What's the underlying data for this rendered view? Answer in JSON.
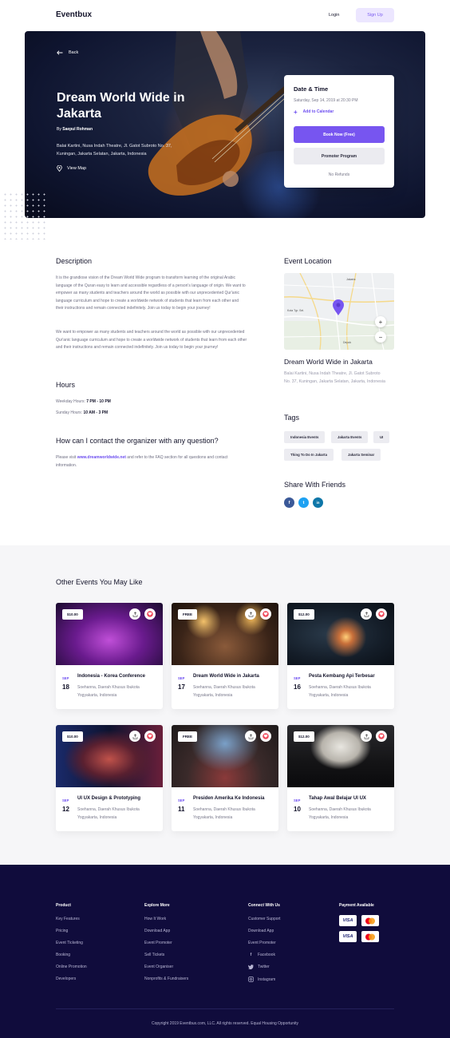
{
  "header": {
    "logo": "Eventbux",
    "login_label": "Login",
    "signup_label": "Sign Up"
  },
  "hero": {
    "back_label": "Back",
    "title": "Dream World Wide in Jakarta",
    "by_prefix": "By",
    "organizer": "Saepul Rohman",
    "address": "Balai Kartini, Nusa Indah Theatre, Jl. Gatot Subroto No. 37, Kuningan, Jakarta Selatan, Jakarta, Indonesia",
    "view_map_label": "View Map"
  },
  "datetime_card": {
    "title": "Date & Time",
    "date": "Saturday, Sep 14, 2019 at 20:30 PM",
    "add_calendar_label": "Add to Calendar",
    "book_label": "Book Now (Free)",
    "promoter_label": "Promoter Program",
    "no_refunds": "No Refunds"
  },
  "description": {
    "heading": "Description",
    "para1": "It is the grandiose vision of the Dream World Wide program to transform learning of the original Arabic language of the Quran easy to learn and accessible regardless of a person's language of origin. We want to empower as many students and teachers around the world as possible with our unprecedented Qur'anic language curriculum and hope to create a worldwide network of students that learn from each other and their instructions and remain connected indefinitely. Join us today to begin your journey!",
    "para2": "We want to empower as many students and teachers around the world as possible with our unprecedented Qur'anic language curriculum and hope to create a worldwide network of students that learn from each other and their instructions and remain connected indefinitely. Join us today to begin your journey!"
  },
  "hours": {
    "heading": "Hours",
    "weekday_label": "Weekday Hours:",
    "weekday_value": "7 PM - 10 PM",
    "sunday_label": "Sunday Hours:",
    "sunday_value": "10 AM - 3 PM"
  },
  "contact": {
    "heading": "How can I contact the organizer with any question?",
    "prefix": "Please visit",
    "link": "www.dreamworldwide.net",
    "suffix": "and refer to the FAQ section for all questions and contact information."
  },
  "location": {
    "heading": "Event Location",
    "map_labels": [
      "Jakarta",
      "Kota Tgr. Sel.",
      "Depok"
    ],
    "zoom_in": "+",
    "zoom_out": "−",
    "venue_title": "Dream World Wide in Jakarta",
    "venue_address": "Balai Kartini, Nusa Indah Theatre, Jl. Gatot Subroto No. 37, Kuningan, Jakarta Selatan, Jakarta, Indonesia"
  },
  "tags": {
    "heading": "Tags",
    "items": [
      "Indonesia Events",
      "Jakarta Events",
      "UI",
      "Thing To Do In Jakarta",
      "Jakarta Seminar"
    ]
  },
  "share": {
    "heading": "Share With Friends",
    "networks": [
      {
        "name": "facebook",
        "glyph": "f",
        "color": "#3b5998"
      },
      {
        "name": "twitter",
        "glyph": "t",
        "color": "#1da1f2"
      },
      {
        "name": "linkedin",
        "glyph": "in",
        "color": "#0e76a8"
      }
    ]
  },
  "other_events": {
    "heading": "Other Events You May Like",
    "events": [
      {
        "price": "$10.00",
        "month": "SEP",
        "day": "18",
        "title": "Indonesia - Korea Conference",
        "location": "Soehanna, Daerah Khusus Ibukota Yogyakarta, Indonesia"
      },
      {
        "price": "FREE",
        "month": "SEP",
        "day": "17",
        "title": "Dream World Wide in Jakarta",
        "location": "Soehanna, Daerah Khusus Ibukota Yogyakarta, Indonesia"
      },
      {
        "price": "$12.00",
        "month": "SEP",
        "day": "16",
        "title": "Pesta Kembang Api Terbesar",
        "location": "Soehanna, Daerah Khusus Ibukota Yogyakarta, Indonesia"
      },
      {
        "price": "$10.00",
        "month": "SEP",
        "day": "12",
        "title": "UI UX Design & Prototyping",
        "location": "Soehanna, Daerah Khusus Ibukota Yogyakarta, Indonesia"
      },
      {
        "price": "FREE",
        "month": "SEP",
        "day": "11",
        "title": "Presiden Amerika Ke Indonesia",
        "location": "Soehanna, Daerah Khusus Ibukota Yogyakarta, Indonesia"
      },
      {
        "price": "$12.00",
        "month": "SEP",
        "day": "10",
        "title": "Tahap Awal Belajar UI UX",
        "location": "Soehanna, Daerah Khusus Ibukota Yogyakarta, Indonesia"
      }
    ]
  },
  "footer": {
    "product": {
      "heading": "Product",
      "items": [
        "Key Features",
        "Pricing",
        "Event Ticketing",
        "Booking",
        "Online Promotion",
        "Developers"
      ]
    },
    "explore": {
      "heading": "Explore More",
      "items": [
        "How It Work",
        "Download App",
        "Event Promoter",
        "Sell Tickets",
        "Event Organiser",
        "Nonprofits & Fundraisers"
      ]
    },
    "connect": {
      "heading": "Connect With Us",
      "items": [
        "Customer Support",
        "Download App",
        "Event Promoter"
      ],
      "social": [
        "Facebook",
        "Twitter",
        "Instagram"
      ]
    },
    "payment": {
      "heading": "Payment Available",
      "cards": [
        "VISA",
        "mastercard",
        "VISA",
        "mastercard"
      ]
    },
    "copyright": "Copyright 2019 Eventbux.com, LLC. All rights reserved. Equal Housing Opportunity"
  },
  "colors": {
    "accent": "#7755f0",
    "footer_bg": "#100c3c",
    "text_dark": "#14142b"
  }
}
